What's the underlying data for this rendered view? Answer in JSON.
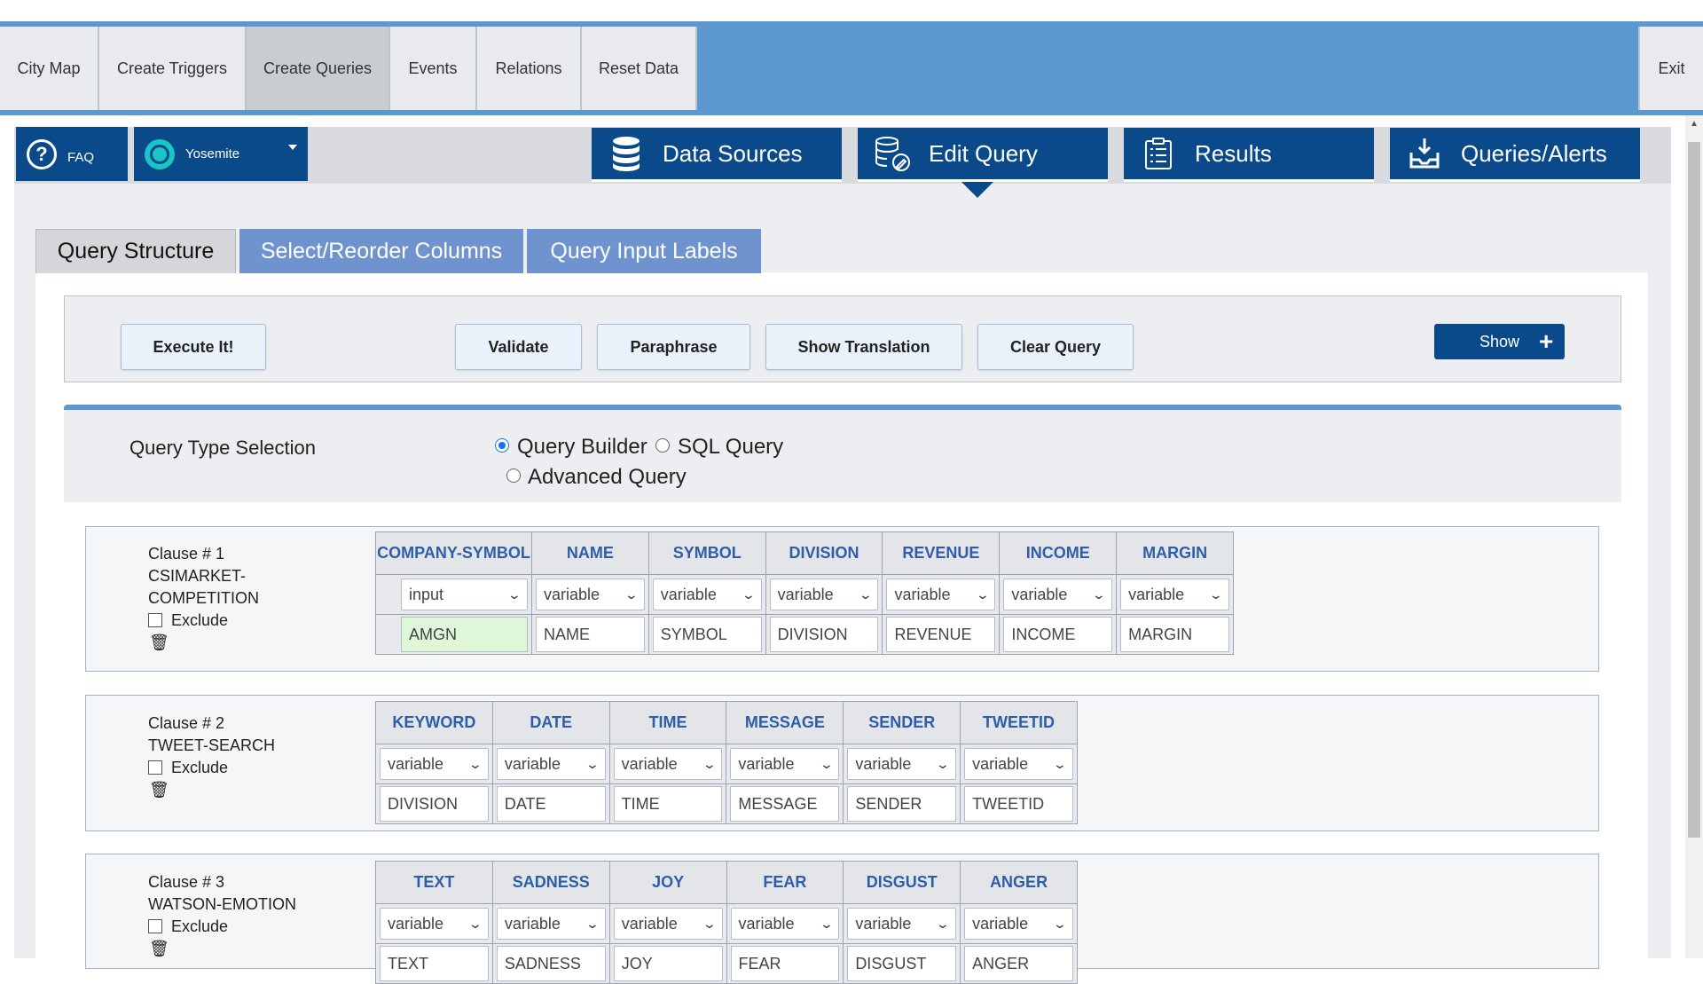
{
  "nav": {
    "tabs": [
      {
        "label": "City Map"
      },
      {
        "label": "Create Triggers"
      },
      {
        "label": "Create Queries"
      },
      {
        "label": "Events"
      },
      {
        "label": "Relations"
      },
      {
        "label": "Reset Data"
      }
    ],
    "exit_label": "Exit"
  },
  "toolbar": {
    "faq_label": "FAQ",
    "user_label": "Yosemite",
    "tabs": [
      {
        "label": "Data Sources",
        "icon": "database-icon"
      },
      {
        "label": "Edit Query",
        "icon": "database-edit-icon"
      },
      {
        "label": "Results",
        "icon": "clipboard-list-icon"
      },
      {
        "label": "Queries/Alerts",
        "icon": "inbox-download-icon"
      }
    ]
  },
  "subtabs": [
    {
      "label": "Query Structure"
    },
    {
      "label": "Select/Reorder Columns"
    },
    {
      "label": "Query Input Labels"
    }
  ],
  "actions": {
    "execute": "Execute It!",
    "validate": "Validate",
    "paraphrase": "Paraphrase",
    "show_translation": "Show Translation",
    "clear_query": "Clear Query",
    "show": "Show"
  },
  "query_type": {
    "title": "Query Type Selection",
    "options": [
      {
        "label": "Query Builder",
        "selected": true
      },
      {
        "label": "SQL Query",
        "selected": false
      },
      {
        "label": "Advanced Query",
        "selected": false
      }
    ]
  },
  "clauses": [
    {
      "number": "Clause # 1",
      "name_line1": "CSIMARKET-",
      "name_line2": "COMPETITION",
      "exclude_label": "Exclude",
      "columns": [
        "COMPANY-SYMBOL",
        "NAME",
        "SYMBOL",
        "DIVISION",
        "REVENUE",
        "INCOME",
        "MARGIN"
      ],
      "types": [
        "input",
        "variable",
        "variable",
        "variable",
        "variable",
        "variable",
        "variable"
      ],
      "values": [
        "AMGN",
        "NAME",
        "SYMBOL",
        "DIVISION",
        "REVENUE",
        "INCOME",
        "MARGIN"
      ]
    },
    {
      "number": "Clause # 2",
      "name_line1": "TWEET-SEARCH",
      "exclude_label": "Exclude",
      "columns": [
        "KEYWORD",
        "DATE",
        "TIME",
        "MESSAGE",
        "SENDER",
        "TWEETID"
      ],
      "types": [
        "variable",
        "variable",
        "variable",
        "variable",
        "variable",
        "variable"
      ],
      "values": [
        "DIVISION",
        "DATE",
        "TIME",
        "MESSAGE",
        "SENDER",
        "TWEETID"
      ]
    },
    {
      "number": "Clause # 3",
      "name_line1": "WATSON-EMOTION",
      "exclude_label": "Exclude",
      "columns": [
        "TEXT",
        "SADNESS",
        "JOY",
        "FEAR",
        "DISGUST",
        "ANGER"
      ],
      "types": [
        "variable",
        "variable",
        "variable",
        "variable",
        "variable",
        "variable"
      ],
      "values": [
        "TEXT",
        "SADNESS",
        "JOY",
        "FEAR",
        "DISGUST",
        "ANGER"
      ]
    }
  ],
  "colors": {
    "nav_bg": "#5b98cf",
    "dark_blue": "#0b4a8a",
    "subtab_blue": "#6f93cf",
    "header_text": "#2e5ea7",
    "input_green": "#ddf7d8"
  }
}
